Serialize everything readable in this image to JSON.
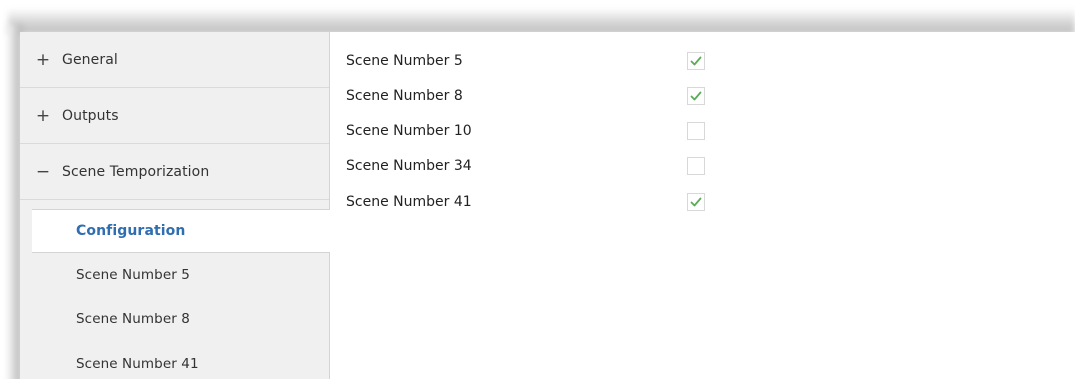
{
  "sidebar": {
    "groups": [
      {
        "sign": "+",
        "label": "General"
      },
      {
        "sign": "+",
        "label": "Outputs"
      },
      {
        "sign": "−",
        "label": "Scene Temporization"
      }
    ],
    "subitems": [
      {
        "label": "Configuration",
        "active": true
      },
      {
        "label": "Scene Number 5",
        "active": false
      },
      {
        "label": "Scene Number 8",
        "active": false
      },
      {
        "label": "Scene Number 41",
        "active": false
      }
    ]
  },
  "main": {
    "rows": [
      {
        "label": "Scene Number 5",
        "checked": true
      },
      {
        "label": "Scene Number 8",
        "checked": true
      },
      {
        "label": "Scene Number 10",
        "checked": false
      },
      {
        "label": "Scene Number 34",
        "checked": false
      },
      {
        "label": "Scene Number 41",
        "checked": true
      }
    ]
  },
  "colors": {
    "accent": "#2f6eb0",
    "check": "#5bab59",
    "sidebar_bg": "#f0f0f0"
  }
}
